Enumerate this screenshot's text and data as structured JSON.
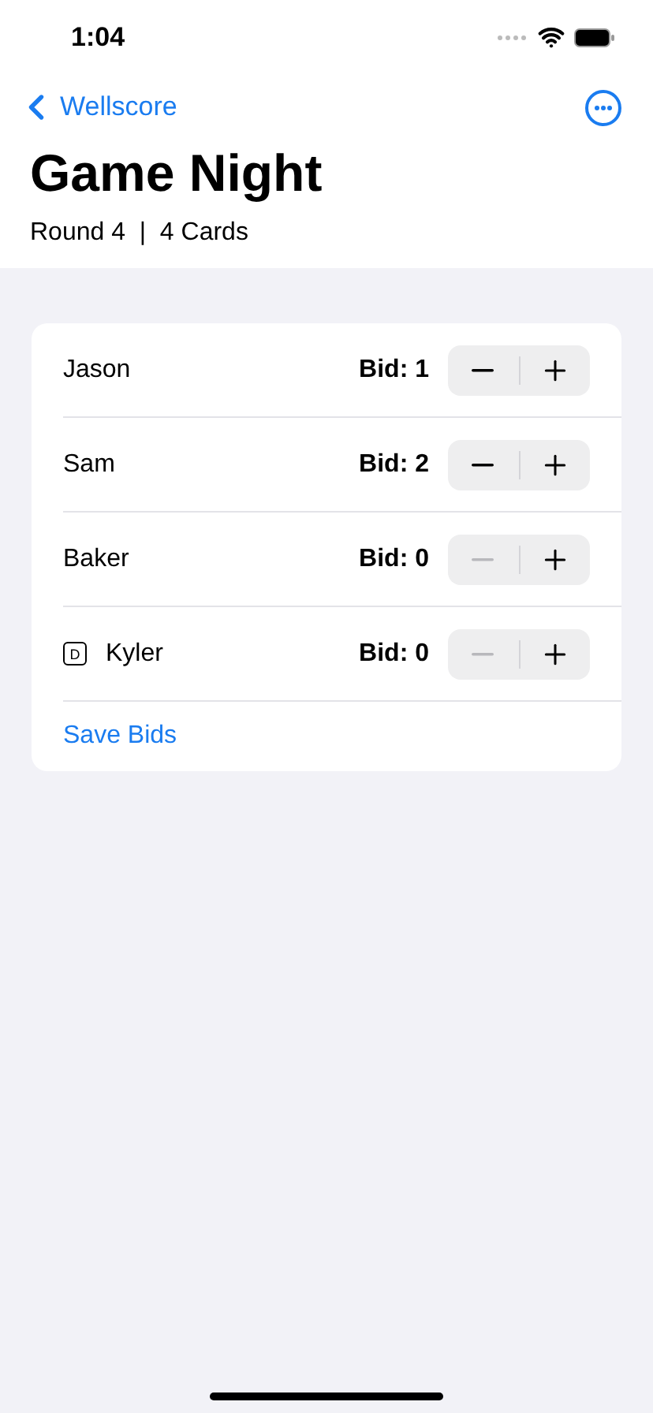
{
  "status_bar": {
    "time": "1:04"
  },
  "nav": {
    "back_label": "Wellscore"
  },
  "title": "Game Night",
  "subtitle": "Round 4  |  4 Cards",
  "players": [
    {
      "name": "Jason",
      "bid": "Bid: 1",
      "decrement_disabled": false
    },
    {
      "name": "Sam",
      "bid": "Bid: 2",
      "decrement_disabled": false
    },
    {
      "name": "Baker",
      "bid": "Bid: 0",
      "decrement_disabled": true
    },
    {
      "name": "Kyler",
      "badge": "D",
      "bid": "Bid: 0",
      "decrement_disabled": true
    }
  ],
  "save_label": "Save Bids"
}
